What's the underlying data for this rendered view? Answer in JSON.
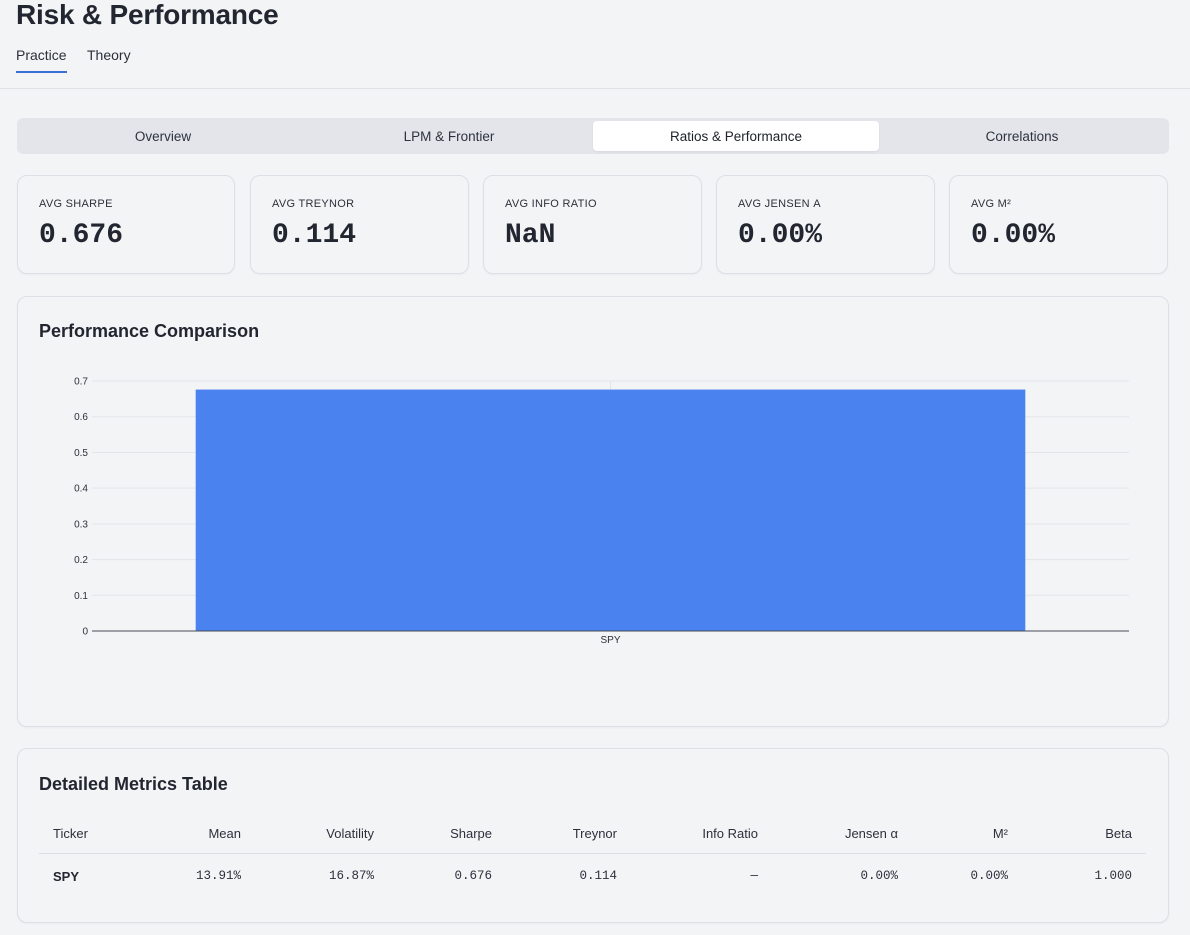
{
  "page": {
    "title": "Risk & Performance"
  },
  "top_tabs": [
    {
      "label": "Practice",
      "active": true
    },
    {
      "label": "Theory",
      "active": false
    }
  ],
  "segments": [
    {
      "label": "Overview",
      "active": false
    },
    {
      "label": "LPM & Frontier",
      "active": false
    },
    {
      "label": "Ratios & Performance",
      "active": true
    },
    {
      "label": "Correlations",
      "active": false
    }
  ],
  "kpis": [
    {
      "label": "AVG SHARPE",
      "value": "0.676"
    },
    {
      "label": "AVG TREYNOR",
      "value": "0.114"
    },
    {
      "label": "AVG INFO RATIO",
      "value": "NaN"
    },
    {
      "label": "AVG JENSEN Α",
      "value": "0.00%"
    },
    {
      "label": "AVG M²",
      "value": "0.00%"
    }
  ],
  "performance": {
    "title": "Performance Comparison",
    "chart_data": {
      "type": "bar",
      "categories": [
        "SPY"
      ],
      "series": [
        {
          "values": [
            0.676
          ]
        }
      ],
      "yticks": [
        "0",
        "0.1",
        "0.2",
        "0.3",
        "0.4",
        "0.5",
        "0.6",
        "0.7"
      ],
      "ylim": [
        0,
        0.7
      ],
      "bar_color": "#4a82f0",
      "grid": true
    }
  },
  "metrics": {
    "title": "Detailed Metrics Table",
    "columns": [
      "Ticker",
      "Mean",
      "Volatility",
      "Sharpe",
      "Treynor",
      "Info Ratio",
      "Jensen α",
      "M²",
      "Beta"
    ],
    "rows": [
      [
        "SPY",
        "13.91%",
        "16.87%",
        "0.676",
        "0.114",
        "—",
        "0.00%",
        "0.00%",
        "1.000"
      ]
    ]
  },
  "colors": {
    "accent": "#3b6fd8",
    "bar": "#4a82f0",
    "background": "#f3f4f6"
  }
}
